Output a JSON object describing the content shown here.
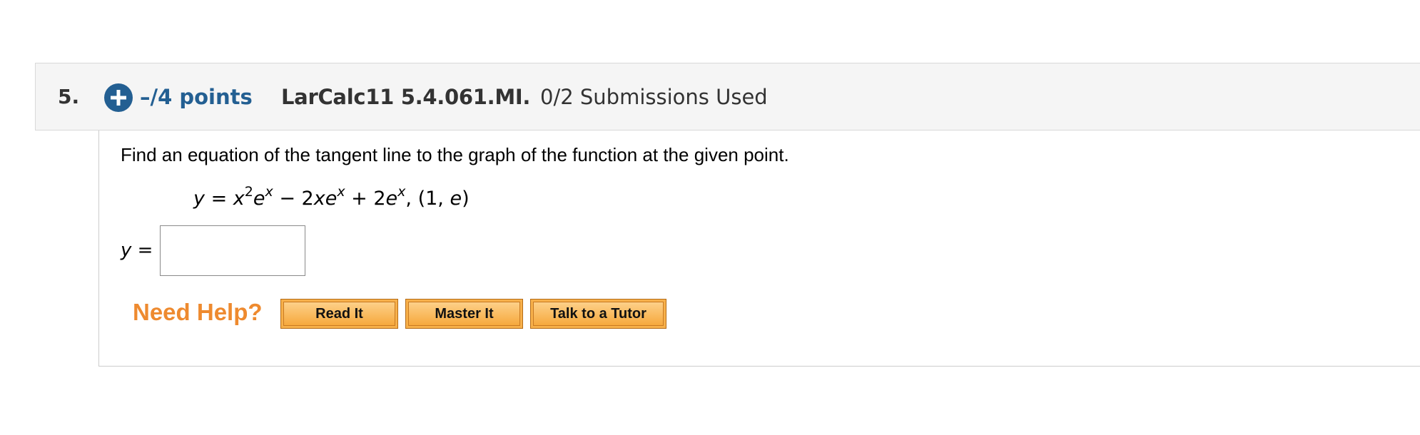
{
  "question": {
    "number": "5.",
    "points": "–/4 points",
    "problem_id": "LarCalc11 5.4.061.MI.",
    "submissions": "0/2 Submissions Used",
    "expand_icon": "plus-circle-icon",
    "accent_color": "#235f92"
  },
  "body": {
    "prompt": "Find an equation of the tangent line to the graph of the function at the given point.",
    "equation": {
      "lhs": "y",
      "eq": " = ",
      "t1_base": "x",
      "t1_exp": "2",
      "t1_base2": "e",
      "t1_exp2": "x",
      "op1": " − 2",
      "t2_x": "x",
      "t2_e": "e",
      "t2_exp": "x",
      "op2": " + 2",
      "t3_e": "e",
      "t3_exp": "x",
      "point_open": ",    (1, ",
      "point_e": "e",
      "point_close": ")"
    },
    "answer": {
      "label_var": "y",
      "label_eq": " =",
      "value": "",
      "placeholder": ""
    }
  },
  "help": {
    "label": "Need Help?",
    "label_color": "#ee8a2f",
    "buttons": {
      "read": "Read It",
      "master": "Master It",
      "tutor": "Talk to a Tutor"
    },
    "button_color": "#f7b04a"
  }
}
